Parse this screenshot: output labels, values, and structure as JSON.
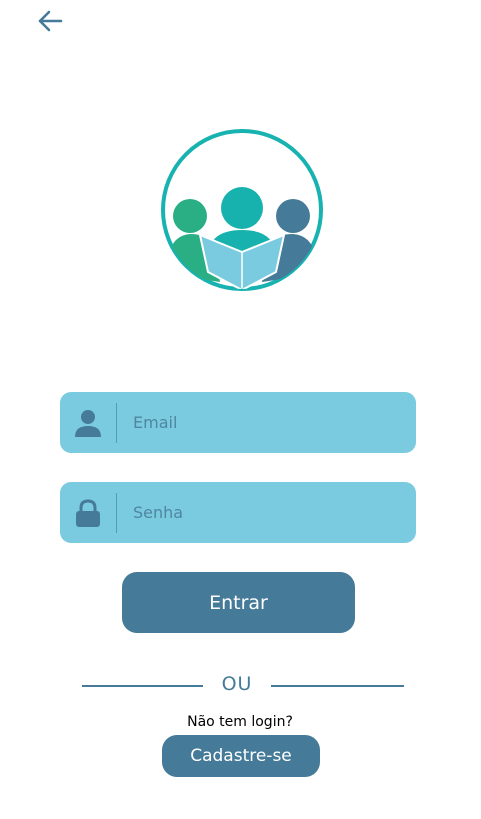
{
  "header": {
    "back_icon": "arrow-left-icon"
  },
  "logo": {
    "icon": "group-people-icon",
    "colors": {
      "ring": "#18b3b0",
      "left_person": "#2aae84",
      "center_person": "#17b2ad",
      "right_person": "#457b98",
      "book": "#7acbe0"
    }
  },
  "form": {
    "email": {
      "placeholder": "Email",
      "value": "",
      "icon": "user-icon"
    },
    "password": {
      "placeholder": "Senha",
      "value": "",
      "icon": "lock-icon"
    },
    "login_label": "Entrar"
  },
  "divider": {
    "label": "OU"
  },
  "signup": {
    "prompt": "Não tem login?",
    "button_label": "Cadastre-se"
  },
  "colors": {
    "primary": "#457b98",
    "field_background": "#7acbe0",
    "accent": "#18b3b0"
  }
}
